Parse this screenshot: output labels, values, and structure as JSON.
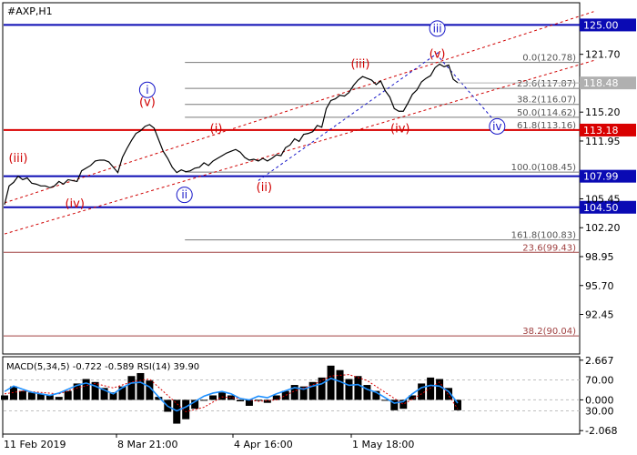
{
  "chart_data": {
    "type": "line",
    "symbol": "#AXP,H1",
    "x_ticks": [
      "11 Feb 2019",
      "8 Mar 21:00",
      "4 Apr 16:00",
      "1 May 18:00"
    ],
    "price_axis": {
      "ylim": [
        88.0,
        127.5
      ],
      "ticks": [
        "121.70",
        "115.20",
        "111.95",
        "105.45",
        "102.20",
        "98.95",
        "95.70",
        "92.45"
      ],
      "tick_values": [
        121.7,
        115.2,
        111.95,
        105.45,
        102.2,
        98.95,
        95.7,
        92.45
      ]
    },
    "level_lines": [
      {
        "label": "125.00",
        "value": 125.0,
        "color": "#0a0ab4"
      },
      {
        "label": "107.99",
        "value": 107.99,
        "color": "#0a0ab4"
      },
      {
        "label": "104.50",
        "value": 104.5,
        "color": "#0a0ab4"
      },
      {
        "label": "113.18",
        "value": 113.18,
        "color": "#d90000"
      }
    ],
    "current_price": {
      "label": "118.48",
      "value": 118.48,
      "color": "#b0b0b0"
    },
    "fib_levels": [
      {
        "label": "0.0(120.78)",
        "value": 120.78
      },
      {
        "label": "23.6(117.87)",
        "value": 117.87
      },
      {
        "label": "38.2(116.07)",
        "value": 116.07
      },
      {
        "label": "50.0(114.62)",
        "value": 114.62
      },
      {
        "label": "61.8(113.16)",
        "value": 113.16
      },
      {
        "label": "100.0(108.45)",
        "value": 108.45
      },
      {
        "label": "161.8(100.83)",
        "value": 100.83
      }
    ],
    "fib_levels_lower": [
      {
        "label": "23.6(99.43)",
        "value": 99.43
      },
      {
        "label": "38.2(90.04)",
        "value": 90.04
      }
    ],
    "wave_labels_red": [
      {
        "label": "(iii)",
        "t": 0.03,
        "price": 109.6
      },
      {
        "label": "(iv)",
        "t": 0.155,
        "price": 104.5
      },
      {
        "label": "(v)",
        "t": 0.315,
        "price": 115.9
      },
      {
        "label": "(i)",
        "t": 0.467,
        "price": 112.9
      },
      {
        "label": "(ii)",
        "t": 0.573,
        "price": 106.3
      },
      {
        "label": "(iii)",
        "t": 0.785,
        "price": 120.2
      },
      {
        "label": "(iv)",
        "t": 0.873,
        "price": 112.9
      },
      {
        "label": "(v)",
        "t": 0.955,
        "price": 121.3
      }
    ],
    "wave_labels_blue": [
      {
        "label": "i",
        "t": 0.315,
        "price": 117.7
      },
      {
        "label": "ii",
        "t": 0.397,
        "price": 105.9
      },
      {
        "label": "iii",
        "t": 0.955,
        "price": 124.6
      },
      {
        "label": "iv",
        "t": 1.087,
        "price": 113.6
      }
    ],
    "price_series": [
      [
        0.0,
        104.8
      ],
      [
        0.01,
        106.9
      ],
      [
        0.02,
        107.3
      ],
      [
        0.03,
        108.0
      ],
      [
        0.04,
        107.6
      ],
      [
        0.05,
        107.8
      ],
      [
        0.06,
        107.2
      ],
      [
        0.07,
        107.1
      ],
      [
        0.08,
        106.9
      ],
      [
        0.09,
        106.9
      ],
      [
        0.1,
        106.7
      ],
      [
        0.11,
        106.9
      ],
      [
        0.12,
        107.4
      ],
      [
        0.13,
        107.1
      ],
      [
        0.14,
        107.6
      ],
      [
        0.15,
        107.5
      ],
      [
        0.16,
        107.4
      ],
      [
        0.17,
        108.6
      ],
      [
        0.18,
        108.9
      ],
      [
        0.19,
        109.2
      ],
      [
        0.2,
        109.7
      ],
      [
        0.21,
        109.8
      ],
      [
        0.22,
        109.8
      ],
      [
        0.23,
        109.6
      ],
      [
        0.24,
        109.0
      ],
      [
        0.25,
        108.4
      ],
      [
        0.26,
        110.1
      ],
      [
        0.27,
        111.1
      ],
      [
        0.28,
        112.0
      ],
      [
        0.29,
        112.8
      ],
      [
        0.3,
        113.1
      ],
      [
        0.31,
        113.6
      ],
      [
        0.32,
        113.8
      ],
      [
        0.33,
        113.4
      ],
      [
        0.34,
        112.1
      ],
      [
        0.35,
        110.8
      ],
      [
        0.36,
        110.0
      ],
      [
        0.37,
        109.0
      ],
      [
        0.38,
        108.4
      ],
      [
        0.39,
        108.7
      ],
      [
        0.4,
        108.5
      ],
      [
        0.41,
        108.6
      ],
      [
        0.42,
        108.9
      ],
      [
        0.43,
        109.0
      ],
      [
        0.44,
        109.5
      ],
      [
        0.45,
        109.2
      ],
      [
        0.46,
        109.7
      ],
      [
        0.47,
        110.0
      ],
      [
        0.48,
        110.3
      ],
      [
        0.49,
        110.6
      ],
      [
        0.5,
        110.8
      ],
      [
        0.51,
        111.0
      ],
      [
        0.52,
        110.7
      ],
      [
        0.53,
        110.1
      ],
      [
        0.54,
        109.8
      ],
      [
        0.55,
        109.9
      ],
      [
        0.56,
        109.7
      ],
      [
        0.57,
        110.0
      ],
      [
        0.58,
        109.7
      ],
      [
        0.59,
        110.0
      ],
      [
        0.6,
        110.4
      ],
      [
        0.61,
        110.3
      ],
      [
        0.62,
        111.2
      ],
      [
        0.63,
        111.5
      ],
      [
        0.64,
        112.2
      ],
      [
        0.65,
        111.9
      ],
      [
        0.66,
        112.7
      ],
      [
        0.67,
        112.8
      ],
      [
        0.68,
        113.0
      ],
      [
        0.69,
        113.7
      ],
      [
        0.7,
        113.5
      ],
      [
        0.71,
        115.6
      ],
      [
        0.72,
        116.5
      ],
      [
        0.73,
        116.7
      ],
      [
        0.74,
        117.1
      ],
      [
        0.75,
        117.0
      ],
      [
        0.76,
        117.4
      ],
      [
        0.77,
        118.2
      ],
      [
        0.78,
        118.8
      ],
      [
        0.79,
        119.2
      ],
      [
        0.8,
        119.0
      ],
      [
        0.81,
        118.8
      ],
      [
        0.82,
        118.3
      ],
      [
        0.83,
        118.7
      ],
      [
        0.84,
        117.6
      ],
      [
        0.85,
        116.9
      ],
      [
        0.86,
        115.6
      ],
      [
        0.87,
        115.3
      ],
      [
        0.88,
        115.3
      ],
      [
        0.89,
        116.2
      ],
      [
        0.9,
        117.2
      ],
      [
        0.91,
        117.7
      ],
      [
        0.92,
        118.6
      ],
      [
        0.93,
        119.0
      ],
      [
        0.94,
        119.3
      ],
      [
        0.95,
        120.2
      ],
      [
        0.96,
        120.6
      ],
      [
        0.97,
        120.3
      ],
      [
        0.98,
        120.5
      ],
      [
        0.99,
        118.9
      ],
      [
        1.0,
        118.5
      ]
    ],
    "indicator": {
      "label": "MACD(5,34,5) -0.722 -0.589 RSI(14) 39.90",
      "left_ticks": [
        "2.667",
        "0.000",
        "-2.068"
      ],
      "left_tick_values": [
        2.667,
        0.0,
        -2.068
      ],
      "right_ticks": [
        "70.00",
        "30.00"
      ],
      "right_tick_values": [
        70,
        30
      ],
      "macd_ylim": [
        -2.3,
        2.9
      ],
      "rsi_ylim": [
        0,
        100
      ],
      "series_colors": {
        "histogram": "#000000",
        "signal": "#d90000",
        "rsi": "#1e90ff"
      },
      "macd_histogram": [
        [
          0.0,
          0.3
        ],
        [
          0.02,
          0.9
        ],
        [
          0.04,
          0.6
        ],
        [
          0.06,
          0.5
        ],
        [
          0.08,
          0.4
        ],
        [
          0.1,
          0.3
        ],
        [
          0.12,
          0.2
        ],
        [
          0.14,
          0.6
        ],
        [
          0.16,
          1.1
        ],
        [
          0.18,
          1.4
        ],
        [
          0.2,
          1.2
        ],
        [
          0.22,
          0.8
        ],
        [
          0.24,
          0.5
        ],
        [
          0.26,
          0.9
        ],
        [
          0.28,
          1.6
        ],
        [
          0.3,
          1.8
        ],
        [
          0.32,
          1.3
        ],
        [
          0.34,
          0.2
        ],
        [
          0.36,
          -0.8
        ],
        [
          0.38,
          -1.6
        ],
        [
          0.4,
          -1.3
        ],
        [
          0.42,
          -0.6
        ],
        [
          0.44,
          0.0
        ],
        [
          0.46,
          0.3
        ],
        [
          0.48,
          0.5
        ],
        [
          0.5,
          0.3
        ],
        [
          0.52,
          -0.1
        ],
        [
          0.54,
          -0.4
        ],
        [
          0.56,
          0.0
        ],
        [
          0.58,
          -0.2
        ],
        [
          0.6,
          0.3
        ],
        [
          0.62,
          0.6
        ],
        [
          0.64,
          1.0
        ],
        [
          0.66,
          0.9
        ],
        [
          0.68,
          1.2
        ],
        [
          0.7,
          1.5
        ],
        [
          0.72,
          2.3
        ],
        [
          0.74,
          2.0
        ],
        [
          0.76,
          1.4
        ],
        [
          0.78,
          1.6
        ],
        [
          0.8,
          1.0
        ],
        [
          0.82,
          0.6
        ],
        [
          0.84,
          0.0
        ],
        [
          0.86,
          -0.7
        ],
        [
          0.88,
          -0.6
        ],
        [
          0.9,
          0.3
        ],
        [
          0.92,
          1.1
        ],
        [
          0.94,
          1.5
        ],
        [
          0.96,
          1.4
        ],
        [
          0.98,
          0.8
        ],
        [
          1.0,
          -0.7
        ]
      ],
      "macd_signal": [
        [
          0.0,
          0.4
        ],
        [
          0.04,
          0.6
        ],
        [
          0.08,
          0.5
        ],
        [
          0.12,
          0.4
        ],
        [
          0.16,
          0.8
        ],
        [
          0.2,
          1.1
        ],
        [
          0.24,
          0.8
        ],
        [
          0.28,
          1.2
        ],
        [
          0.32,
          1.4
        ],
        [
          0.36,
          0.3
        ],
        [
          0.4,
          -0.8
        ],
        [
          0.44,
          -0.5
        ],
        [
          0.48,
          0.2
        ],
        [
          0.52,
          0.1
        ],
        [
          0.56,
          -0.1
        ],
        [
          0.6,
          0.0
        ],
        [
          0.64,
          0.6
        ],
        [
          0.68,
          1.0
        ],
        [
          0.72,
          1.6
        ],
        [
          0.76,
          1.7
        ],
        [
          0.8,
          1.3
        ],
        [
          0.84,
          0.5
        ],
        [
          0.88,
          -0.3
        ],
        [
          0.92,
          0.4
        ],
        [
          0.96,
          1.2
        ],
        [
          1.0,
          -0.6
        ]
      ],
      "rsi": [
        [
          0.0,
          55
        ],
        [
          0.02,
          62
        ],
        [
          0.04,
          58
        ],
        [
          0.06,
          54
        ],
        [
          0.08,
          52
        ],
        [
          0.1,
          50
        ],
        [
          0.12,
          53
        ],
        [
          0.14,
          58
        ],
        [
          0.16,
          63
        ],
        [
          0.18,
          66
        ],
        [
          0.2,
          62
        ],
        [
          0.22,
          57
        ],
        [
          0.24,
          52
        ],
        [
          0.26,
          60
        ],
        [
          0.28,
          66
        ],
        [
          0.3,
          67
        ],
        [
          0.32,
          61
        ],
        [
          0.34,
          48
        ],
        [
          0.36,
          36
        ],
        [
          0.38,
          30
        ],
        [
          0.4,
          35
        ],
        [
          0.42,
          42
        ],
        [
          0.44,
          49
        ],
        [
          0.46,
          53
        ],
        [
          0.48,
          55
        ],
        [
          0.5,
          52
        ],
        [
          0.52,
          46
        ],
        [
          0.54,
          44
        ],
        [
          0.56,
          49
        ],
        [
          0.58,
          47
        ],
        [
          0.6,
          52
        ],
        [
          0.62,
          56
        ],
        [
          0.64,
          60
        ],
        [
          0.66,
          58
        ],
        [
          0.68,
          62
        ],
        [
          0.7,
          65
        ],
        [
          0.72,
          72
        ],
        [
          0.74,
          68
        ],
        [
          0.76,
          63
        ],
        [
          0.78,
          64
        ],
        [
          0.8,
          58
        ],
        [
          0.82,
          54
        ],
        [
          0.84,
          47
        ],
        [
          0.86,
          40
        ],
        [
          0.88,
          42
        ],
        [
          0.9,
          52
        ],
        [
          0.92,
          60
        ],
        [
          0.94,
          63
        ],
        [
          0.96,
          62
        ],
        [
          0.98,
          55
        ],
        [
          1.0,
          40
        ]
      ]
    }
  }
}
